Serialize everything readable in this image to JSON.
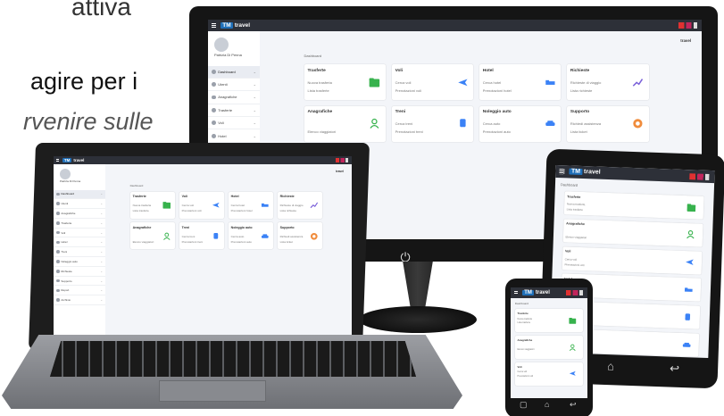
{
  "background_text": {
    "line1": "attiva",
    "line2": "agire per i",
    "line3": "rvenire sulle"
  },
  "app": {
    "brand_tag": "TM",
    "brand_name": "travel",
    "page_title": "Dashboard",
    "user": "Patrizia Di Penna",
    "corner_logo": "travel"
  },
  "sidebar": {
    "items": [
      {
        "label": "Dashboard"
      },
      {
        "label": "Utenti"
      },
      {
        "label": "Anagrafiche"
      },
      {
        "label": "Trasferte"
      },
      {
        "label": "Voli"
      },
      {
        "label": "Hotel"
      },
      {
        "label": "Treni"
      },
      {
        "label": "Noleggio auto"
      },
      {
        "label": "Richieste"
      },
      {
        "label": "Supporto"
      },
      {
        "label": "Report"
      },
      {
        "label": "Archivio"
      }
    ]
  },
  "cards": [
    {
      "title": "Trasferte",
      "line1": "Nuova trasferta",
      "line2": "Lista trasferte",
      "icon": "folder-icon",
      "color": "#37b24d"
    },
    {
      "title": "Voli",
      "line1": "Cerca voli",
      "line2": "Prenotazioni voli",
      "icon": "plane-icon",
      "color": "#3b82f6"
    },
    {
      "title": "Hotel",
      "line1": "Cerca hotel",
      "line2": "Prenotazioni hotel",
      "icon": "bed-icon",
      "color": "#3b82f6"
    },
    {
      "title": "Richieste",
      "line1": "Richieste di viaggio",
      "line2": "Lista richieste",
      "icon": "chart-line-icon",
      "color": "#7b61d9"
    },
    {
      "title": "Anagrafiche",
      "line1": "",
      "line2": "Elenco viaggiatori",
      "icon": "person-icon",
      "color": "#37b24d"
    },
    {
      "title": "Treni",
      "line1": "Cerca treni",
      "line2": "Prenotazioni treni",
      "icon": "train-icon",
      "color": "#3b82f6"
    },
    {
      "title": "Noleggio auto",
      "line1": "Cerca auto",
      "line2": "Prenotazioni auto",
      "icon": "car-icon",
      "color": "#3b82f6"
    },
    {
      "title": "Supporto",
      "line1": "Richiedi assistenza",
      "line2": "Lista ticket",
      "icon": "lifebuoy-icon",
      "color": "#f08c3c"
    }
  ],
  "device_icons": {
    "power": "⏻",
    "home": "⌂",
    "back": "↩",
    "square": "▢",
    "circle": "○"
  }
}
